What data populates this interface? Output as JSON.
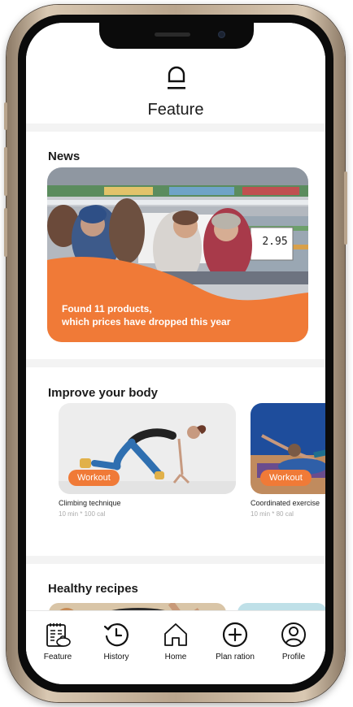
{
  "header": {
    "title": "Feature",
    "icon": "bell-icon"
  },
  "news": {
    "title": "News",
    "banner_line1": "Found 11 products,",
    "banner_line2": "which prices have dropped this year",
    "price_tag": "2.95"
  },
  "improve": {
    "title": "Improve your body",
    "cards": [
      {
        "badge": "Workout",
        "name": "Climbing technique",
        "meta": "10 min * 100 cal"
      },
      {
        "badge": "Workout",
        "name": "Coordinated exercise",
        "meta": "10 min * 80 cal"
      }
    ]
  },
  "recipes": {
    "title": "Healthy recipes"
  },
  "tabbar": {
    "items": [
      {
        "label": "Feature",
        "icon": "feature-document-icon"
      },
      {
        "label": "History",
        "icon": "history-clock-icon"
      },
      {
        "label": "Home",
        "icon": "home-icon"
      },
      {
        "label": "Plan ration",
        "icon": "plus-circle-icon"
      },
      {
        "label": "Profile",
        "icon": "profile-icon"
      }
    ]
  },
  "colors": {
    "accent": "#f07a37",
    "text": "#1b1b1b",
    "muted": "#aaaaaa",
    "background": "#f3f3f3"
  }
}
